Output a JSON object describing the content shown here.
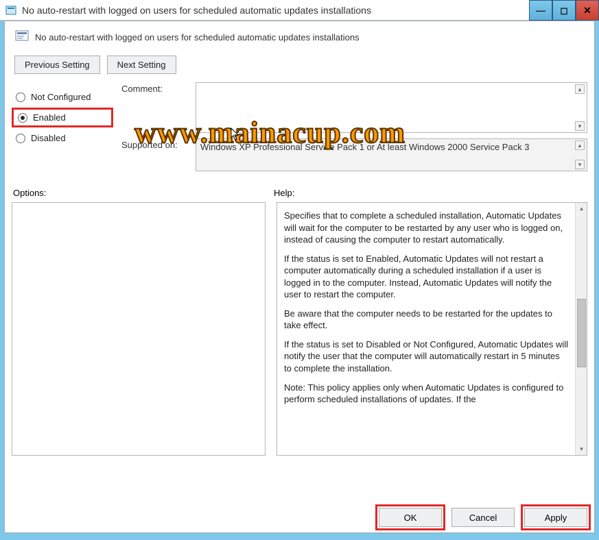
{
  "window": {
    "title": "No auto-restart with logged on users for scheduled automatic updates installations"
  },
  "header": {
    "title": "No auto-restart with logged on users for scheduled automatic updates installations"
  },
  "nav": {
    "previous": "Previous Setting",
    "next": "Next Setting"
  },
  "states": {
    "not_configured_label": "Not Configured",
    "enabled_label": "Enabled",
    "disabled_label": "Disabled",
    "selected": "enabled"
  },
  "form": {
    "comment_label": "Comment:",
    "comment_value": "",
    "supported_label": "Supported on:",
    "supported_value": "Windows XP Professional Service Pack 1 or At least Windows 2000 Service Pack 3"
  },
  "sections": {
    "options_label": "Options:",
    "help_label": "Help:"
  },
  "help": {
    "p1": "Specifies that to complete a scheduled installation, Automatic Updates will wait for the computer to be restarted by any user who is logged on, instead of causing the computer to restart automatically.",
    "p2": "If the status is set to Enabled, Automatic Updates will not restart a computer automatically during a scheduled installation if a user is logged in to the computer. Instead, Automatic Updates will notify the user to restart the computer.",
    "p3": "Be aware that the computer needs to be restarted for the updates to take effect.",
    "p4": "If the status is set to Disabled or Not Configured, Automatic Updates will notify the user that the computer will automatically restart in 5 minutes to complete the installation.",
    "p5": "Note: This policy applies only when Automatic Updates is configured to perform scheduled installations of updates. If the"
  },
  "buttons": {
    "ok": "OK",
    "cancel": "Cancel",
    "apply": "Apply"
  },
  "watermark": "www.mainacup.com",
  "win_controls": {
    "minimize": "—",
    "maximize": "◻",
    "close": "✕"
  }
}
